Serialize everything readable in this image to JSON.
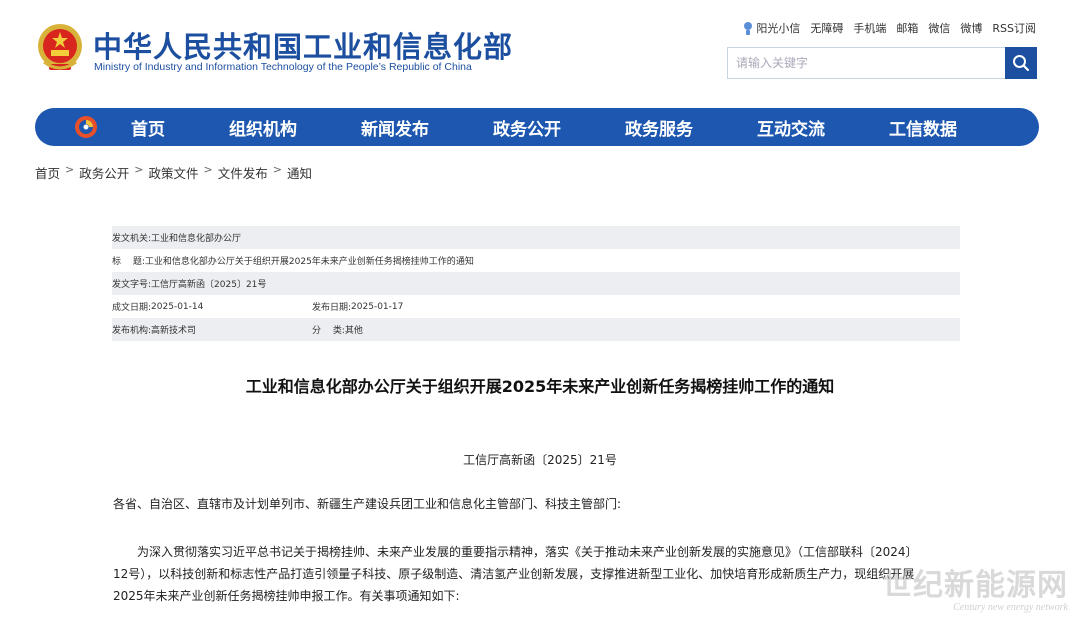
{
  "header": {
    "site_title": "中华人民共和国工业和信息化部",
    "site_subtitle": "Ministry of Industry and Information Technology of the People’s Republic of China",
    "top_links": [
      "阳光小信",
      "无障碍",
      "手机端",
      "邮箱",
      "微信",
      "微博",
      "RSS订阅"
    ],
    "search_placeholder": "请输入关键字",
    "brand_color": "#1d4fa0"
  },
  "nav": {
    "items": [
      "首页",
      "组织机构",
      "新闻发布",
      "政务公开",
      "政务服务",
      "互动交流",
      "工信数据"
    ],
    "background": "#1d57b0"
  },
  "breadcrumb": [
    "首页",
    "政务公开",
    "政策文件",
    "文件发布",
    "通知"
  ],
  "meta": {
    "issuer_label": "发文机关:",
    "issuer": "工业和信息化部办公厅",
    "title_label": "标　 题:",
    "title": "工业和信息化部办公厅关于组织开展2025年未来产业创新任务揭榜挂帅工作的通知",
    "docno_label": "发文字号:",
    "docno": "工信厅高新函〔2025〕21号",
    "created_label": "成文日期:",
    "created": "2025-01-14",
    "published_label": "发布日期:",
    "published": "2025-01-17",
    "org_label": "发布机构:",
    "org": "高新技术司",
    "category_label": "分　 类:",
    "category": "其他"
  },
  "article": {
    "title": "工业和信息化部办公厅关于组织开展2025年未来产业创新任务揭榜挂帅工作的通知",
    "doc_number": "工信厅高新函〔2025〕21号",
    "addressee": "各省、自治区、直辖市及计划单列市、新疆生产建设兵团工业和信息化主管部门、科技主管部门:",
    "paragraph_line1": "为深入贯彻落实习近平总书记关于揭榜挂帅、未来产业发展的重要指示精神，落实《关于推动未来产业创新发展的实施意见》（工信部联科〔2024〕",
    "paragraph_line2": "12号），以科技创新和标志性产品打造引领量子科技、原子级制造、清洁氢产业创新发展，支撑推进新型工业化、加快培育形成新质生产力，现组织开展",
    "paragraph_line3": "2025年未来产业创新任务揭榜挂帅申报工作。有关事项通知如下:"
  },
  "watermark": {
    "main": "世纪新能源网",
    "sub": "Century new energy network"
  }
}
